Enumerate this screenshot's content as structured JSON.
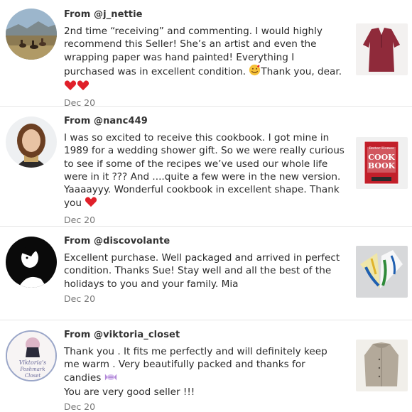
{
  "reviews": [
    {
      "from": "From @j_nettie",
      "text_before": "2nd time “receiving” and commenting. I would highly recommend this Seller! She’s an artist and even the wrapping paper was hand painted! Everything I purchased was in excellent condition. ",
      "text_middle": "Thank you, dear. ",
      "date": "Dec 20"
    },
    {
      "from": "From @nanc449",
      "text": "I was so excited to receive this cookbook. I got mine in 1989 for a wedding shower gift. So we were really curious to see if some of the recipes we’ve used our whole life were in it ??? And ....quite a few were in the new version. Yaaaayyy. Wonderful cookbook in excellent shape. Thank you ",
      "date": "Dec 20",
      "book_line1": "Better Homes",
      "book_line2": "COOK",
      "book_line3": "BOOK"
    },
    {
      "from": "From @discovolante",
      "text": "Excellent purchase. Well packaged and arrived in perfect condition. Thanks Sue! Stay well and all the best of the holidays to you and your family. Mia",
      "date": "Dec 20"
    },
    {
      "from": "From @viktoria_closet",
      "text": "Thank you . It fits me perfectly and will definitely keep me warm . Very beautifully packed and thanks for candies ",
      "text_after": "You are very good seller !!!",
      "date": "Dec 20",
      "avatar_line1": "Viktoria's",
      "avatar_line2": "Poshmark",
      "avatar_line3": "Closet"
    }
  ],
  "colors": {
    "heart": "#e0202a",
    "divider": "#e6e6e6",
    "date": "#777777"
  }
}
